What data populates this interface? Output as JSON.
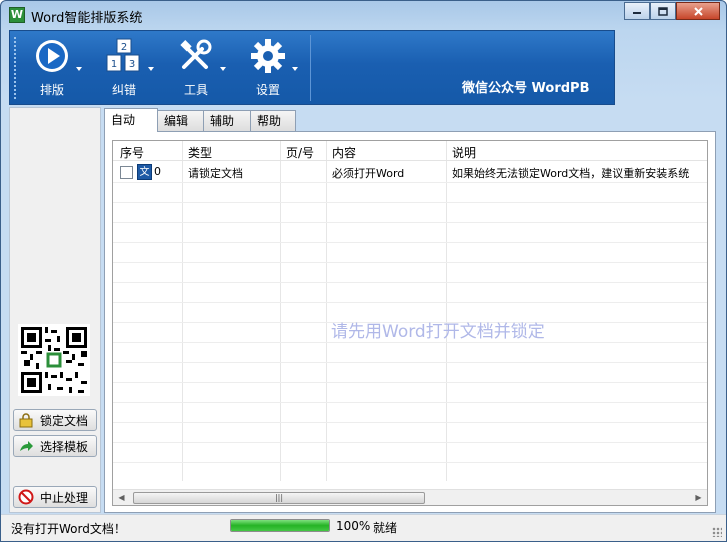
{
  "window": {
    "title": "Word智能排版系统",
    "app_icon": "W"
  },
  "ribbon": {
    "buttons": [
      {
        "label": "排版",
        "icon": "play-icon"
      },
      {
        "label": "纠错",
        "icon": "number-blocks-icon"
      },
      {
        "label": "工具",
        "icon": "tools-icon"
      },
      {
        "label": "设置",
        "icon": "gear-icon"
      }
    ],
    "brand": "微信公众号  WordPB"
  },
  "left_panel": {
    "lock_label": "锁定文档",
    "template_label": "选择模板",
    "stop_label": "中止处理"
  },
  "tabs": [
    {
      "label": "自动",
      "active": true
    },
    {
      "label": "编辑",
      "active": false
    },
    {
      "label": "辅助",
      "active": false
    },
    {
      "label": "帮助",
      "active": false
    }
  ],
  "table": {
    "headers": [
      "序号",
      "类型",
      "页/号",
      "内容",
      "说明"
    ],
    "rows": [
      {
        "index": "0",
        "doc_icon": "文",
        "type": "请锁定文档",
        "page": "",
        "content": "必须打开Word",
        "note": "如果始终无法锁定Word文档，建议重新安装系统"
      }
    ]
  },
  "watermark": "请先用Word打开文档并锁定",
  "status": {
    "message": "没有打开Word文档！",
    "progress": 100,
    "percent": "100%",
    "state": "就绪"
  },
  "colors": {
    "ribbon": "#1a5fb1",
    "progress": "#25b325",
    "watermark": "#b0b8e8"
  }
}
